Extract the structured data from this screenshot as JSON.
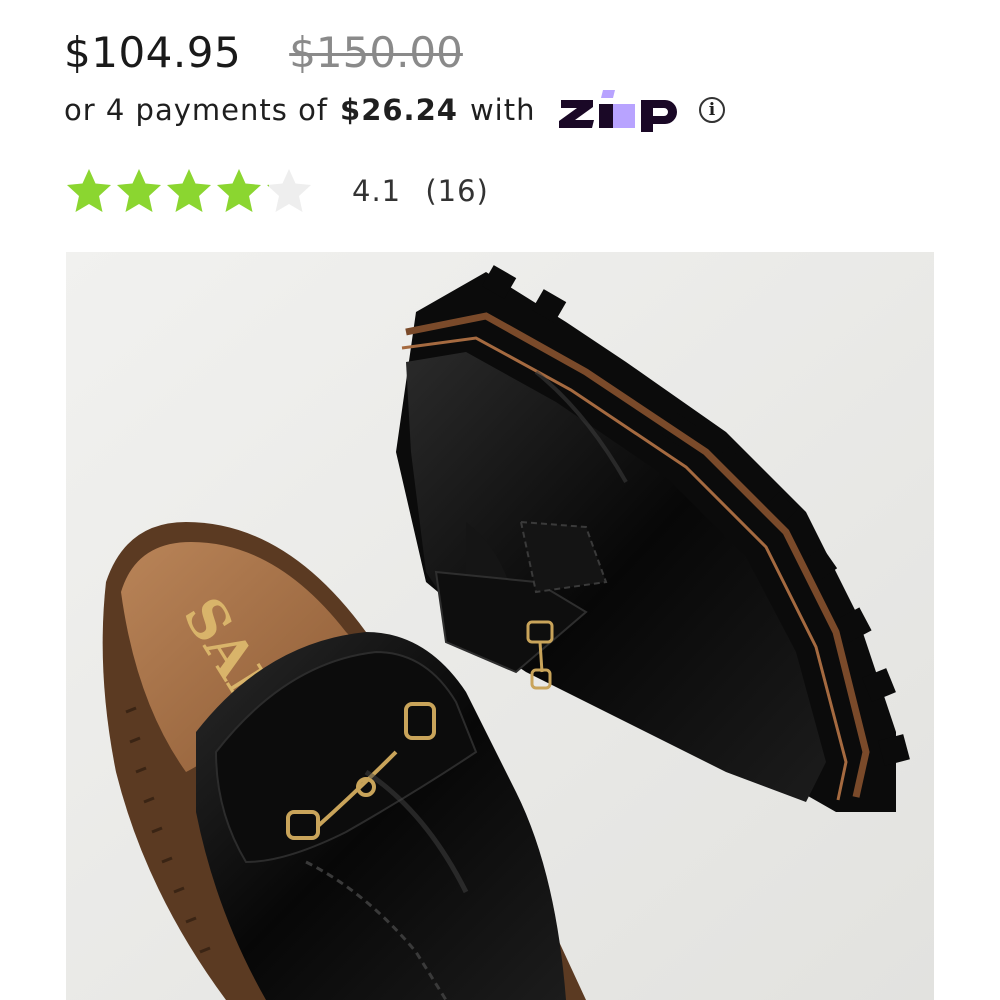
{
  "price": {
    "current": "$104.95",
    "original": "$150.00"
  },
  "payments": {
    "prefix": "or 4 payments of",
    "amount": "$26.24",
    "suffix": "with",
    "provider_logo": "zip-logo",
    "info_icon": "info-icon"
  },
  "rating": {
    "value": 4.1,
    "max": 5,
    "score_text": "4.1",
    "count_text": "(16)",
    "star_color": "#8bd630",
    "empty_star_color": "#eeeeee"
  },
  "product_image": {
    "subject": "black-loafer-mules-icon",
    "insole_logo_text": "SAM"
  },
  "colors": {
    "zip_purple": "#b8a3ff",
    "zip_navy": "#1a0826",
    "image_background": "#ececea"
  }
}
